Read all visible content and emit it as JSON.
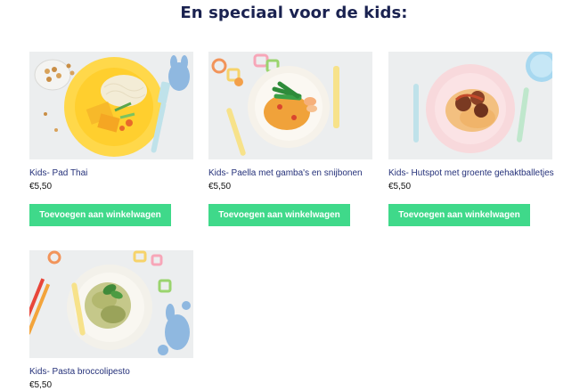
{
  "section": {
    "title": "En speciaal voor de kids:"
  },
  "products": [
    {
      "name": "Kids- Pad Thai",
      "price": "€5,50",
      "button": "Toevoegen aan winkelwagen"
    },
    {
      "name": "Kids- Paella met gamba's en snijbonen",
      "price": "€5,50",
      "button": "Toevoegen aan winkelwagen"
    },
    {
      "name": "Kids- Hutspot met groente gehaktballetjes",
      "price": "€5,50",
      "button": "Toevoegen aan winkelwagen"
    },
    {
      "name": "Kids- Pasta broccolipesto",
      "price": "€5,50"
    }
  ],
  "colors": {
    "button": "#3fd98a",
    "title": "#1a2250",
    "product_name": "#25317a"
  }
}
